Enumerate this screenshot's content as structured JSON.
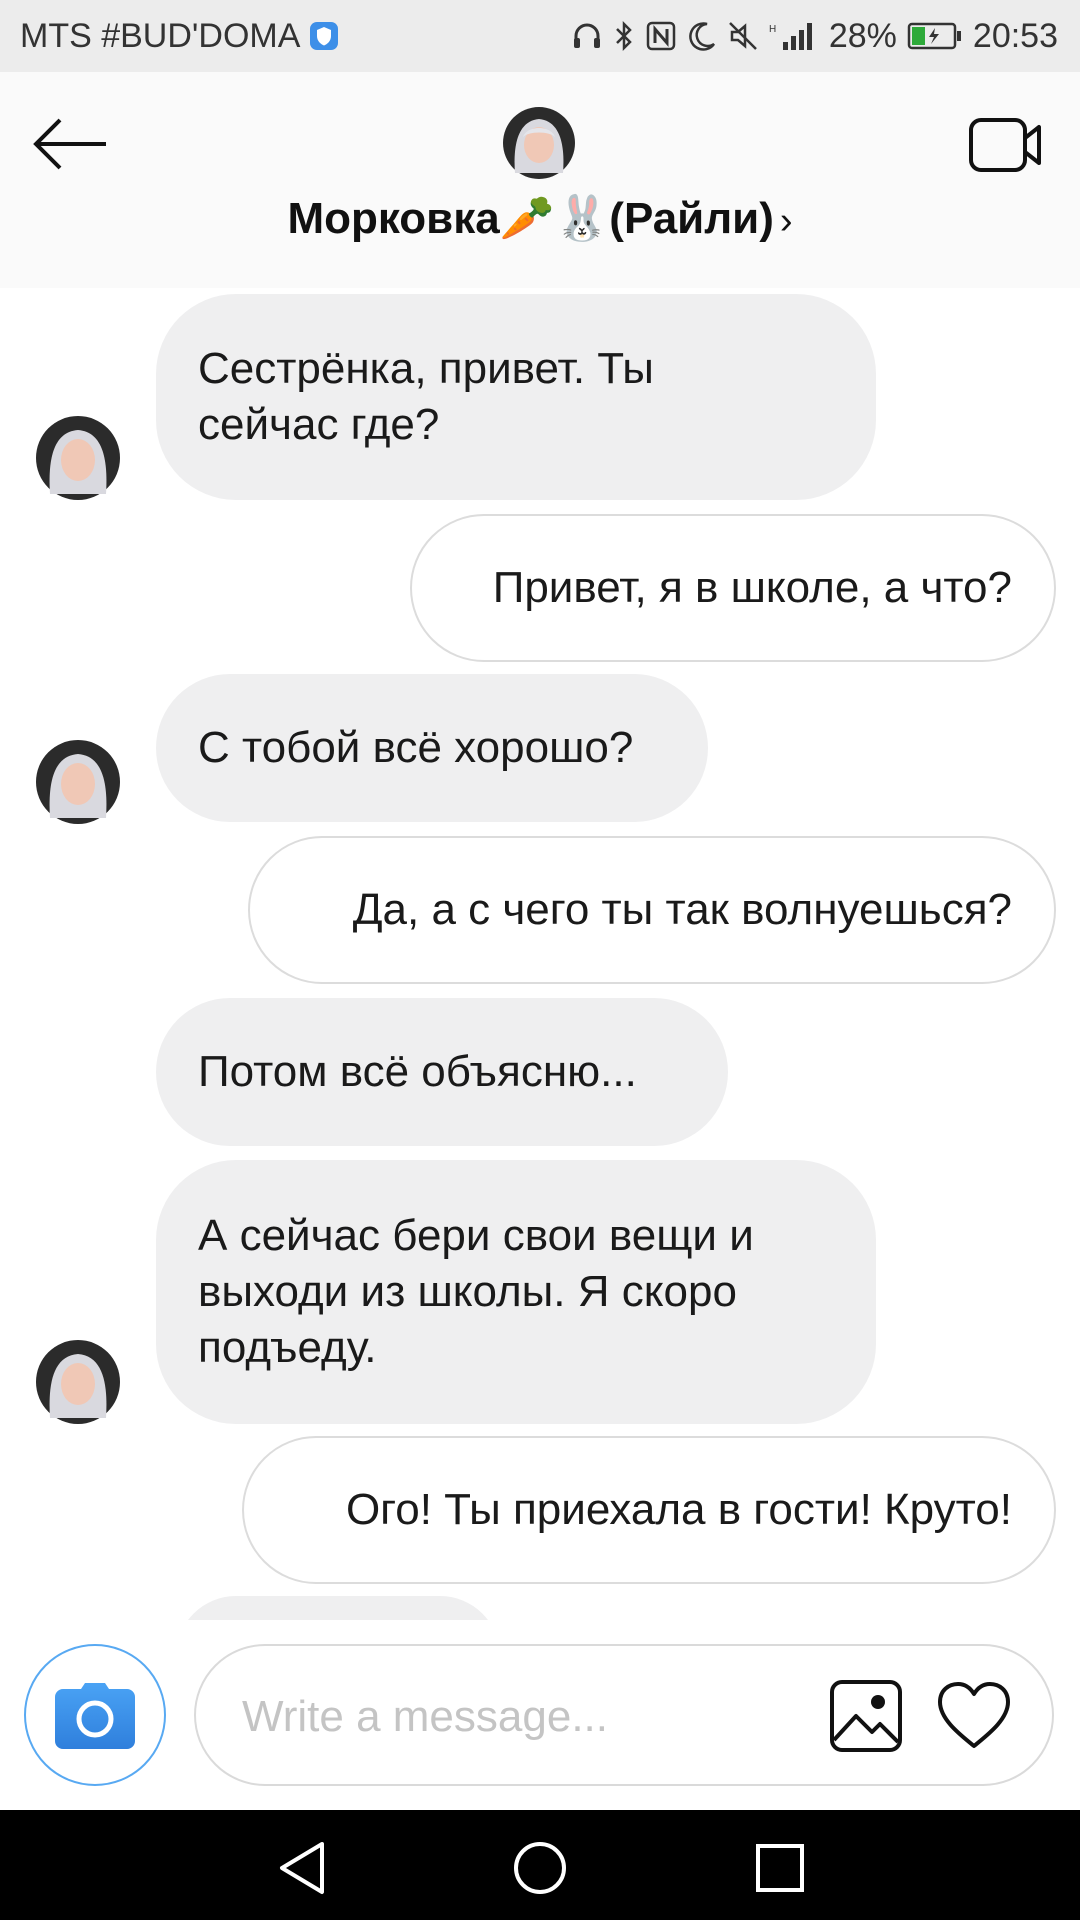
{
  "status": {
    "carrier": "MTS #BUD'DOMA",
    "battery": "28%",
    "time": "20:53",
    "icons": [
      "shield-icon",
      "headphones-icon",
      "bluetooth-icon",
      "nfc-icon",
      "moon-icon",
      "mute-icon",
      "signal-icon",
      "battery-icon"
    ],
    "colors": {
      "shield": "#3d8fe8",
      "battery_fill": "#2eaa3a"
    }
  },
  "header": {
    "title": "Морковка🥕🐰(Райли)",
    "chevron": "›",
    "icons": {
      "back": "back-arrow-icon",
      "video": "video-call-icon"
    }
  },
  "messages": [
    {
      "side": "in",
      "text": "Сестрёнка, привет. Ты\nсейчас где?",
      "avatar": true
    },
    {
      "side": "out",
      "text": "Привет, я в школе, а что?"
    },
    {
      "side": "in",
      "text": "С тобой всё хорошо?",
      "avatar": true
    },
    {
      "side": "out",
      "text": "Да, а с чего ты так волнуешься?"
    },
    {
      "side": "in",
      "text": "Потом всё объясню...",
      "avatar": false
    },
    {
      "side": "in",
      "text": "А сейчас бери свои вещи и\nвыходи из школы. Я скоро\nподъеду.",
      "avatar": true
    },
    {
      "side": "out",
      "text": "Ого! Ты приехала в гости! Круто!"
    }
  ],
  "composer": {
    "placeholder": "Write a message...",
    "value": "",
    "icons": {
      "camera": "camera-icon",
      "gallery": "gallery-icon",
      "like": "heart-icon"
    },
    "accent": "#3b8fe6"
  },
  "navbar": {
    "icons": [
      "nav-back-icon",
      "nav-home-icon",
      "nav-recents-icon"
    ]
  }
}
